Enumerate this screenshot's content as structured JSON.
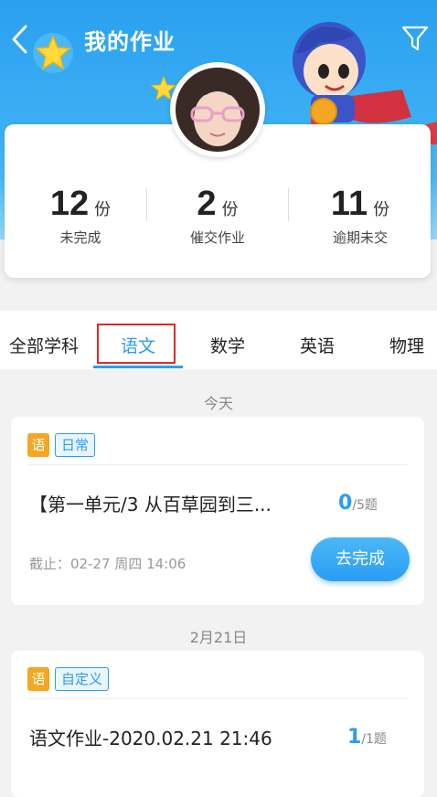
{
  "header": {
    "title": "我的作业"
  },
  "stats": [
    {
      "count": "12",
      "unit": "份",
      "label": "未完成"
    },
    {
      "count": "2",
      "unit": "份",
      "label": "催交作业"
    },
    {
      "count": "11",
      "unit": "份",
      "label": "逾期未交"
    }
  ],
  "tabs": [
    {
      "label": "全部学科"
    },
    {
      "label": "语文",
      "active": true
    },
    {
      "label": "数学"
    },
    {
      "label": "英语"
    },
    {
      "label": "物理"
    }
  ],
  "sections": [
    {
      "date": "今天",
      "item": {
        "subject_badge": "语",
        "tag": "日常",
        "title": "【第一单元/3 从百草园到三...",
        "done": "0",
        "total": "/5题",
        "deadline": "截止：02-27 周四 14:06",
        "action": "去完成"
      }
    },
    {
      "date": "2月21日",
      "item": {
        "subject_badge": "语",
        "tag": "自定义",
        "title": "语文作业-2020.02.21 21:46",
        "done": "1",
        "total": "/1题"
      }
    }
  ],
  "colors": {
    "primary": "#2a9df4",
    "highlight_box": "#e0282a",
    "subject_badge": "#f5a623"
  }
}
